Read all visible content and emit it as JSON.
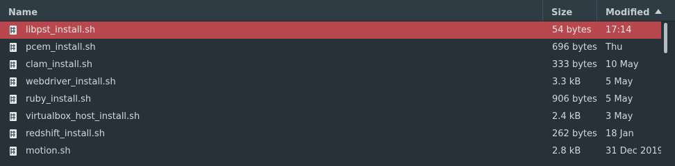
{
  "columns": {
    "name": "Name",
    "size": "Size",
    "modified": "Modified",
    "sort_indicator": "sort-ascending-icon"
  },
  "colors": {
    "background": "#263238",
    "header": "#2f3c43",
    "selection": "#b8474e",
    "text": "#cfd8dc"
  },
  "files": [
    {
      "name": "libpst_install.sh",
      "size": "54 bytes",
      "modified": "17:14",
      "icon": "script-file-icon",
      "selected": true
    },
    {
      "name": "pcem_install.sh",
      "size": "696 bytes",
      "modified": "Thu",
      "icon": "script-file-icon"
    },
    {
      "name": "clam_install.sh",
      "size": "333 bytes",
      "modified": "10 May",
      "icon": "script-file-icon"
    },
    {
      "name": "webdriver_install.sh",
      "size": "3.3 kB",
      "modified": "5 May",
      "icon": "script-file-icon"
    },
    {
      "name": "ruby_install.sh",
      "size": "906 bytes",
      "modified": "5 May",
      "icon": "script-file-icon"
    },
    {
      "name": "virtualbox_host_install.sh",
      "size": "2.4 kB",
      "modified": "3 May",
      "icon": "script-file-icon"
    },
    {
      "name": "redshift_install.sh",
      "size": "262 bytes",
      "modified": "18 Jan",
      "icon": "script-file-icon"
    },
    {
      "name": "motion.sh",
      "size": "2.8 kB",
      "modified": "31 Dec 2019",
      "icon": "script-file-icon"
    }
  ]
}
